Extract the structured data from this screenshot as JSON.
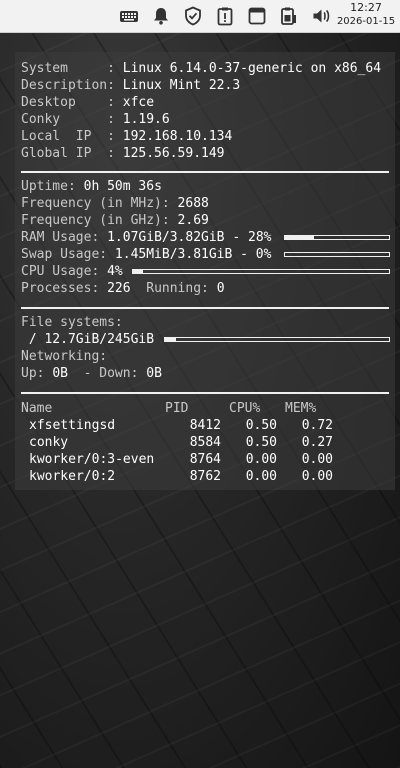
{
  "panel": {
    "time": "12:27",
    "date": "2026-01-15",
    "icons": [
      "keyboard-icon",
      "bell-icon",
      "shield-icon",
      "clipboard-alert-icon",
      "window-icon",
      "battery-clipboard-icon",
      "volume-icon"
    ]
  },
  "system": {
    "rows": [
      {
        "key": "System     :",
        "value": "Linux 6.14.0-37-generic on x86_64"
      },
      {
        "key": "Description:",
        "value": "Linux Mint 22.3"
      },
      {
        "key": "Desktop    :",
        "value": "xfce"
      },
      {
        "key": "Conky      :",
        "value": "1.19.6"
      },
      {
        "key": "Local  IP  :",
        "value": "192.168.10.134"
      },
      {
        "key": "Global IP  :",
        "value": "125.56.59.149"
      }
    ]
  },
  "stats": {
    "uptime_label": "Uptime:",
    "uptime_value": "0h 50m 36s",
    "freq_mhz_label": "Frequency (in MHz):",
    "freq_mhz_value": "2688",
    "freq_ghz_label": "Frequency (in GHz):",
    "freq_ghz_value": "2.69",
    "ram_label": "RAM Usage:",
    "ram_value": "1.07GiB/3.82GiB - 28%",
    "ram_percent": 28,
    "swap_label": "Swap Usage:",
    "swap_value": "1.45MiB/3.81GiB - 0%",
    "swap_percent": 0,
    "cpu_label": "CPU Usage:",
    "cpu_value": "4%",
    "cpu_percent": 4,
    "processes_label": "Processes:",
    "processes_value": "226",
    "running_label": "Running:",
    "running_value": "0"
  },
  "storage": {
    "fs_label": "File systems:",
    "fs_value": " / 12.7GiB/245GiB",
    "fs_percent": 5,
    "net_label": "Networking:",
    "up_label": "Up:",
    "up_value": "0B",
    "down_label": "- Down:",
    "down_value": "0B"
  },
  "processes": {
    "headers": [
      "Name",
      "PID",
      "CPU%",
      "MEM%"
    ],
    "rows": [
      {
        "name": "xfsettingsd",
        "pid": "8412",
        "cpu": "0.50",
        "mem": "0.72"
      },
      {
        "name": "conky",
        "pid": "8584",
        "cpu": "0.50",
        "mem": "0.27"
      },
      {
        "name": "kworker/0:3-even",
        "pid": "8764",
        "cpu": "0.00",
        "mem": "0.00"
      },
      {
        "name": "kworker/0:2",
        "pid": "8762",
        "cpu": "0.00",
        "mem": "0.00"
      }
    ]
  }
}
